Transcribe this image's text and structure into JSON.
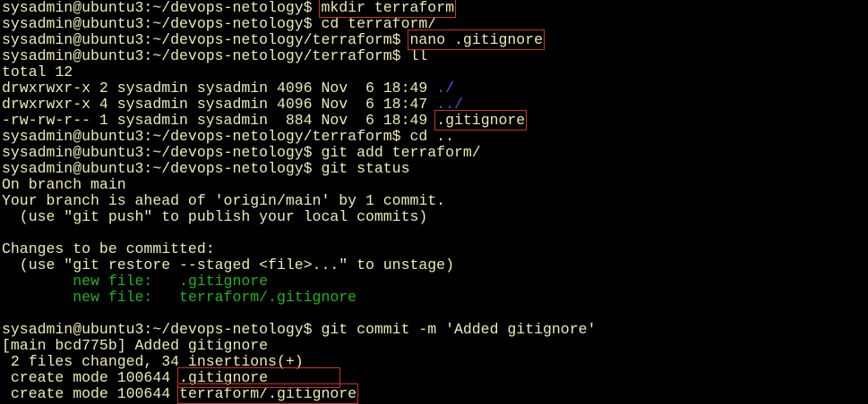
{
  "colors": {
    "text": "#ecebb2",
    "green": "#1fb31f",
    "blue": "#3f5fe0",
    "highlight_box": "#c8302c",
    "background": "#000000"
  },
  "terminal": {
    "lines": [
      [
        {
          "t": "sysadmin@ubuntu3:~/devops-netology$ "
        },
        {
          "t": "mkdir terraform",
          "box": true
        }
      ],
      [
        {
          "t": "sysadmin@ubuntu3:~/devops-netology$ cd terraform/"
        }
      ],
      [
        {
          "t": "sysadmin@ubuntu3:~/devops-netology/terraform$ "
        },
        {
          "t": "nano .gitignore",
          "box": true
        }
      ],
      [
        {
          "t": "sysadmin@ubuntu3:~/devops-netology/terraform$ ll"
        }
      ],
      [
        {
          "t": "total 12"
        }
      ],
      [
        {
          "t": "drwxrwxr-x 2 sysadmin sysadmin 4096 Nov  6 18:49 "
        },
        {
          "t": "./",
          "c": "blue"
        }
      ],
      [
        {
          "t": "drwxrwxr-x 4 sysadmin sysadmin 4096 Nov  6 18:47 "
        },
        {
          "t": "../",
          "c": "blue"
        }
      ],
      [
        {
          "t": "-rw-rw-r-- 1 sysadmin sysadmin  884 Nov  6 18:49 "
        },
        {
          "t": ".gitignore",
          "box": true
        }
      ],
      [
        {
          "t": "sysadmin@ubuntu3:~/devops-netology/terraform$ cd .."
        }
      ],
      [
        {
          "t": "sysadmin@ubuntu3:~/devops-netology$ git add terraform/"
        }
      ],
      [
        {
          "t": "sysadmin@ubuntu3:~/devops-netology$ git status"
        }
      ],
      [
        {
          "t": "On branch main"
        }
      ],
      [
        {
          "t": "Your branch is ahead of 'origin/main' by 1 commit."
        }
      ],
      [
        {
          "t": "  (use \"git push\" to publish your local commits)"
        }
      ],
      [
        {
          "t": ""
        }
      ],
      [
        {
          "t": "Changes to be committed:"
        }
      ],
      [
        {
          "t": "  (use \"git restore --staged <file>...\" to unstage)"
        }
      ],
      [
        {
          "t": "        "
        },
        {
          "t": "new file:   .gitignore",
          "c": "green"
        }
      ],
      [
        {
          "t": "        "
        },
        {
          "t": "new file:   terraform/.gitignore",
          "c": "green"
        }
      ],
      [
        {
          "t": ""
        }
      ],
      [
        {
          "t": "sysadmin@ubuntu3:~/devops-netology$ git commit -m 'Added gitignore'"
        }
      ],
      [
        {
          "t": "[main bcd775b] Added gitignore"
        }
      ],
      [
        {
          "t": " 2 files changed, 34 insertions(+)"
        }
      ],
      [
        {
          "t": " create mode 100644 "
        },
        {
          "t": ".gitignore        ",
          "box": true
        }
      ],
      [
        {
          "t": " create mode 100644 "
        },
        {
          "t": "terraform/.gitignore",
          "box": true
        }
      ]
    ]
  }
}
